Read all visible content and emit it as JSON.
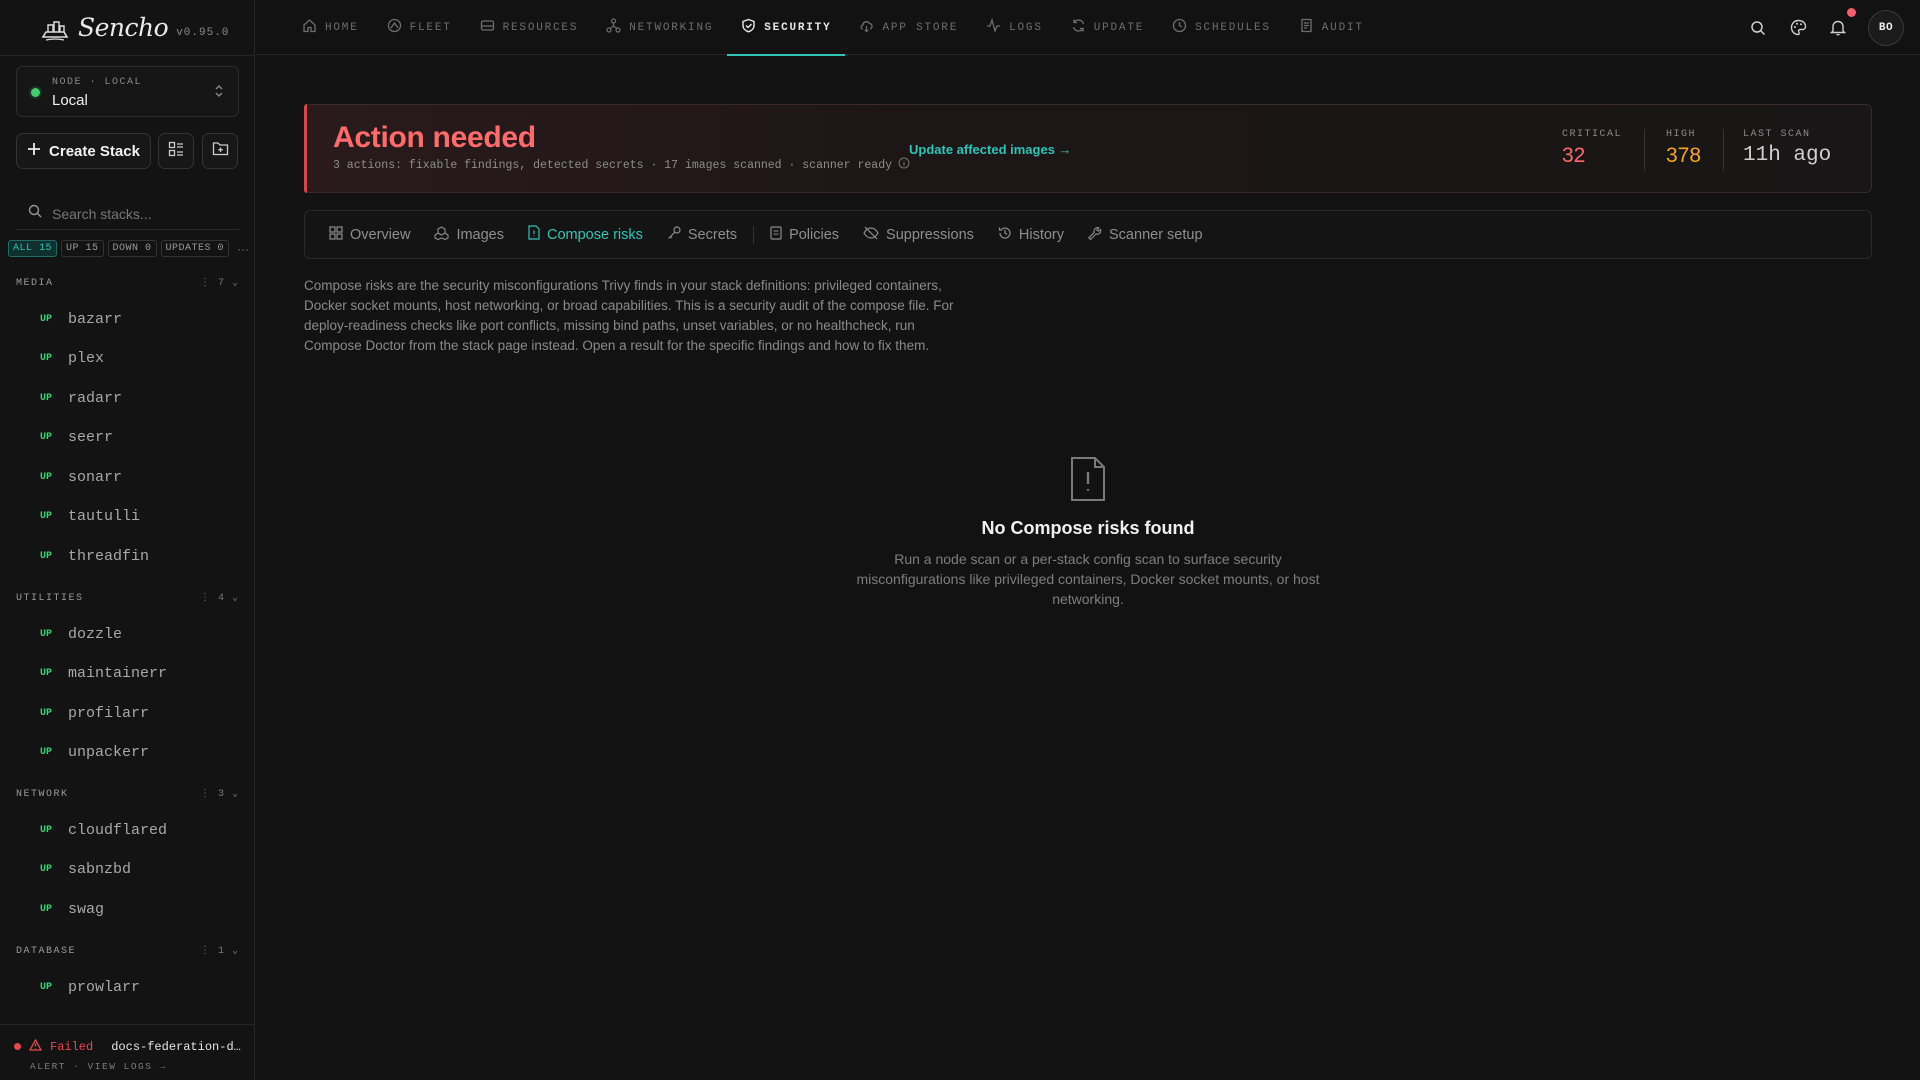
{
  "brand": {
    "name": "Sencho",
    "version": "v0.95.0"
  },
  "node": {
    "label": "NODE · LOCAL",
    "value": "Local"
  },
  "sidebar": {
    "create_label": "Create Stack",
    "search_placeholder": "Search stacks...",
    "filters": [
      "ALL 15",
      "UP 15",
      "DOWN 0",
      "UPDATES 0"
    ],
    "filters_more": "···",
    "groups": [
      {
        "name": "MEDIA",
        "count": "7",
        "items": [
          {
            "status": "UP",
            "name": "bazarr"
          },
          {
            "status": "UP",
            "name": "plex"
          },
          {
            "status": "UP",
            "name": "radarr"
          },
          {
            "status": "UP",
            "name": "seerr"
          },
          {
            "status": "UP",
            "name": "sonarr"
          },
          {
            "status": "UP",
            "name": "tautulli"
          },
          {
            "status": "UP",
            "name": "threadfin"
          }
        ]
      },
      {
        "name": "UTILITIES",
        "count": "4",
        "items": [
          {
            "status": "UP",
            "name": "dozzle"
          },
          {
            "status": "UP",
            "name": "maintainerr"
          },
          {
            "status": "UP",
            "name": "profilarr"
          },
          {
            "status": "UP",
            "name": "unpackerr"
          }
        ]
      },
      {
        "name": "NETWORK",
        "count": "3",
        "items": [
          {
            "status": "UP",
            "name": "cloudflared"
          },
          {
            "status": "UP",
            "name": "sabnzbd"
          },
          {
            "status": "UP",
            "name": "swag"
          }
        ]
      },
      {
        "name": "DATABASE",
        "count": "1",
        "items": [
          {
            "status": "UP",
            "name": "prowlarr"
          }
        ]
      }
    ],
    "footer": {
      "status": "Failed",
      "stack": "docs-federation-de...",
      "actions": "ALERT · VIEW LOGS →"
    }
  },
  "topnav": {
    "items": [
      "HOME",
      "FLEET",
      "RESOURCES",
      "NETWORKING",
      "SECURITY",
      "APP STORE",
      "LOGS",
      "UPDATE",
      "SCHEDULES",
      "AUDIT"
    ],
    "active": "SECURITY",
    "avatar": "BO"
  },
  "banner": {
    "title": "Action needed",
    "subtitle": "3 actions: fixable findings, detected secrets · 17 images scanned · scanner ready",
    "link": "Update affected images →",
    "critical_label": "CRITICAL",
    "critical_value": "32",
    "high_label": "HIGH",
    "high_value": "378",
    "last_scan_label": "LAST SCAN",
    "last_scan_value": "11h ago"
  },
  "tabs": {
    "items": [
      "Overview",
      "Images",
      "Compose risks",
      "Secrets",
      "Policies",
      "Suppressions",
      "History",
      "Scanner setup"
    ],
    "active": "Compose risks"
  },
  "description": "Compose risks are the security misconfigurations Trivy finds in your stack definitions: privileged containers, Docker socket mounts, host networking, or broad capabilities. This is a security audit of the compose file. For deploy-readiness checks like port conflicts, missing bind paths, unset variables, or no healthcheck, run Compose Doctor from the stack page instead. Open a result for the specific findings and how to fix them.",
  "empty": {
    "title": "No Compose risks found",
    "body": "Run a node scan or a per-stack config scan to surface security misconfigurations like privileged containers, Docker socket mounts, or host networking."
  },
  "colors": {
    "accent": "#2ec4b6",
    "critical": "#ff6b6b",
    "high": "#f5a623",
    "up": "#3ecf73",
    "failed": "#e5484d"
  },
  "icons": {
    "topnav": [
      "home-icon",
      "fleet-icon",
      "resources-icon",
      "networking-icon",
      "security-shield-icon",
      "app-store-icon",
      "logs-icon",
      "update-icon",
      "schedules-icon",
      "audit-icon"
    ],
    "tabs": [
      "overview-icon",
      "images-icon",
      "compose-file-icon",
      "secrets-key-icon",
      "policies-icon",
      "suppressions-icon",
      "history-icon",
      "scanner-setup-icon"
    ]
  }
}
